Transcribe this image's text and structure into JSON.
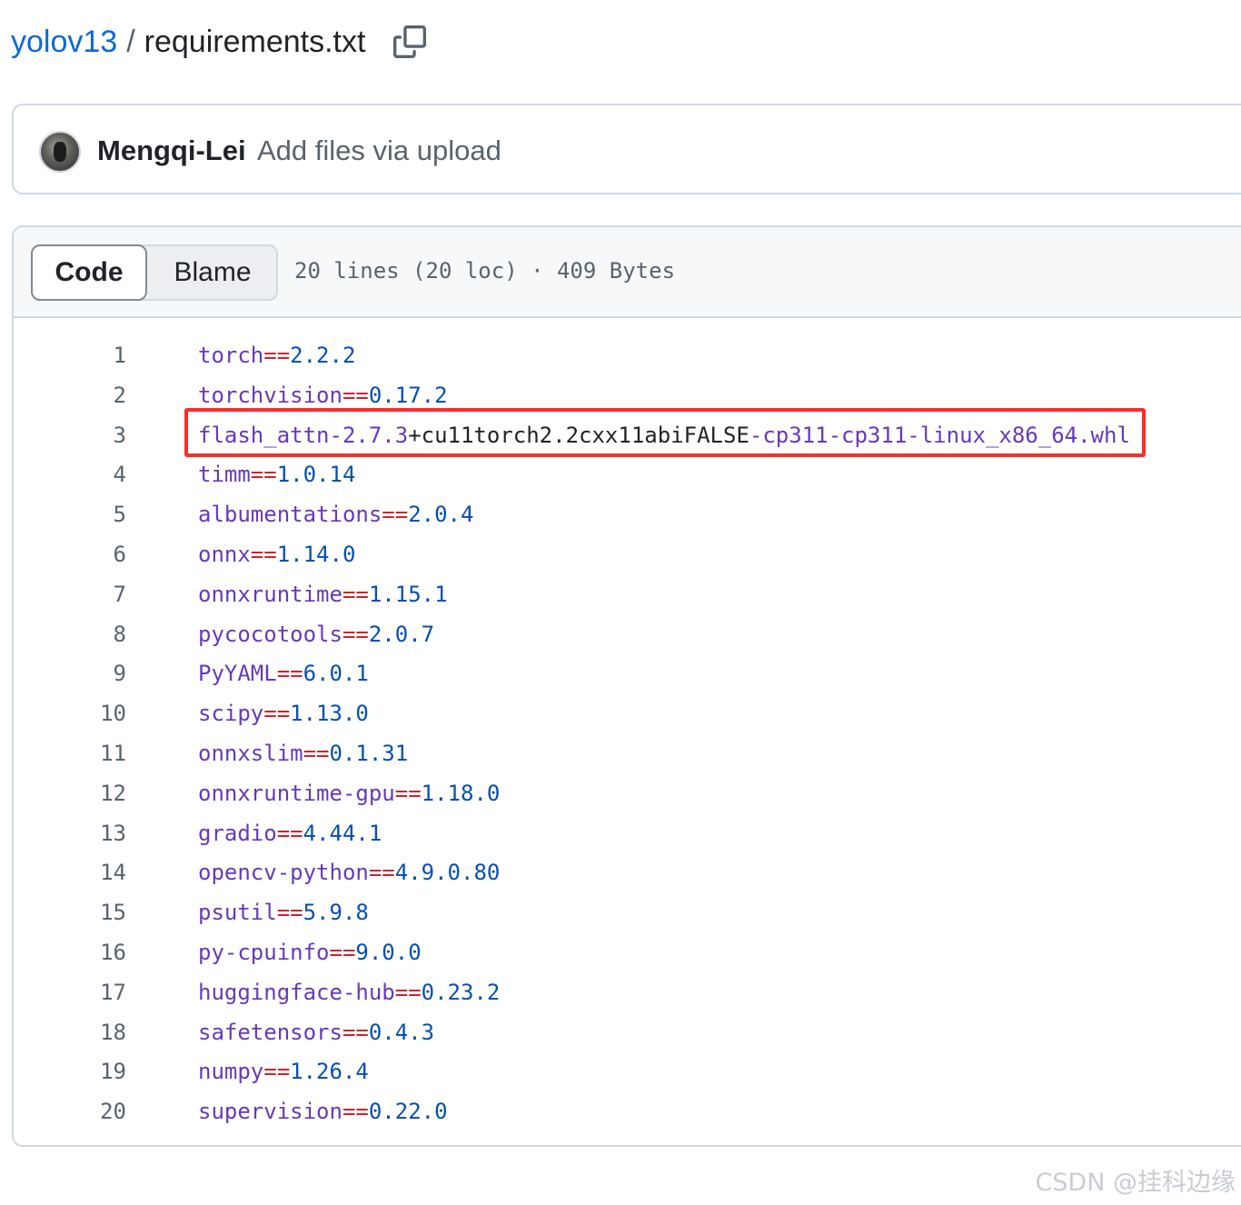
{
  "breadcrumb": {
    "repo": "yolov13",
    "separator": "/",
    "file": "requirements.txt"
  },
  "commit": {
    "author": "Mengqi-Lei",
    "message": "Add files via upload"
  },
  "file_header": {
    "tabs": [
      {
        "label": "Code",
        "active": true
      },
      {
        "label": "Blame",
        "active": false
      }
    ],
    "meta": "20 lines (20 loc) · 409 Bytes"
  },
  "code_lines": [
    {
      "num": "1",
      "tokens": [
        {
          "t": "name",
          "v": "torch"
        },
        {
          "t": "op",
          "v": "=="
        },
        {
          "t": "ver",
          "v": "2.2.2"
        }
      ]
    },
    {
      "num": "2",
      "tokens": [
        {
          "t": "name",
          "v": "torchvision"
        },
        {
          "t": "op",
          "v": "=="
        },
        {
          "t": "ver",
          "v": "0.17.2"
        }
      ]
    },
    {
      "num": "3",
      "tokens": [
        {
          "t": "name",
          "v": "flash_attn-2.7.3"
        },
        {
          "t": "plain",
          "v": "+cu11torch2.2cxx11abiFALSE"
        },
        {
          "t": "name",
          "v": "-cp311-cp311-linux_x86_64.whl"
        }
      ],
      "highlighted": true
    },
    {
      "num": "4",
      "tokens": [
        {
          "t": "name",
          "v": "timm"
        },
        {
          "t": "op",
          "v": "=="
        },
        {
          "t": "ver",
          "v": "1.0.14"
        }
      ]
    },
    {
      "num": "5",
      "tokens": [
        {
          "t": "name",
          "v": "albumentations"
        },
        {
          "t": "op",
          "v": "=="
        },
        {
          "t": "ver",
          "v": "2.0.4"
        }
      ]
    },
    {
      "num": "6",
      "tokens": [
        {
          "t": "name",
          "v": "onnx"
        },
        {
          "t": "op",
          "v": "=="
        },
        {
          "t": "ver",
          "v": "1.14.0"
        }
      ]
    },
    {
      "num": "7",
      "tokens": [
        {
          "t": "name",
          "v": "onnxruntime"
        },
        {
          "t": "op",
          "v": "=="
        },
        {
          "t": "ver",
          "v": "1.15.1"
        }
      ]
    },
    {
      "num": "8",
      "tokens": [
        {
          "t": "name",
          "v": "pycocotools"
        },
        {
          "t": "op",
          "v": "=="
        },
        {
          "t": "ver",
          "v": "2.0.7"
        }
      ]
    },
    {
      "num": "9",
      "tokens": [
        {
          "t": "name",
          "v": "PyYAML"
        },
        {
          "t": "op",
          "v": "=="
        },
        {
          "t": "ver",
          "v": "6.0.1"
        }
      ]
    },
    {
      "num": "10",
      "tokens": [
        {
          "t": "name",
          "v": "scipy"
        },
        {
          "t": "op",
          "v": "=="
        },
        {
          "t": "ver",
          "v": "1.13.0"
        }
      ]
    },
    {
      "num": "11",
      "tokens": [
        {
          "t": "name",
          "v": "onnxslim"
        },
        {
          "t": "op",
          "v": "=="
        },
        {
          "t": "ver",
          "v": "0.1.31"
        }
      ]
    },
    {
      "num": "12",
      "tokens": [
        {
          "t": "name",
          "v": "onnxruntime-gpu"
        },
        {
          "t": "op",
          "v": "=="
        },
        {
          "t": "ver",
          "v": "1.18.0"
        }
      ]
    },
    {
      "num": "13",
      "tokens": [
        {
          "t": "name",
          "v": "gradio"
        },
        {
          "t": "op",
          "v": "=="
        },
        {
          "t": "ver",
          "v": "4.44.1"
        }
      ]
    },
    {
      "num": "14",
      "tokens": [
        {
          "t": "name",
          "v": "opencv-python"
        },
        {
          "t": "op",
          "v": "=="
        },
        {
          "t": "ver",
          "v": "4.9.0.80"
        }
      ]
    },
    {
      "num": "15",
      "tokens": [
        {
          "t": "name",
          "v": "psutil"
        },
        {
          "t": "op",
          "v": "=="
        },
        {
          "t": "ver",
          "v": "5.9.8"
        }
      ]
    },
    {
      "num": "16",
      "tokens": [
        {
          "t": "name",
          "v": "py-cpuinfo"
        },
        {
          "t": "op",
          "v": "=="
        },
        {
          "t": "ver",
          "v": "9.0.0"
        }
      ]
    },
    {
      "num": "17",
      "tokens": [
        {
          "t": "name",
          "v": "huggingface-hub"
        },
        {
          "t": "op",
          "v": "=="
        },
        {
          "t": "ver",
          "v": "0.23.2"
        }
      ]
    },
    {
      "num": "18",
      "tokens": [
        {
          "t": "name",
          "v": "safetensors"
        },
        {
          "t": "op",
          "v": "=="
        },
        {
          "t": "ver",
          "v": "0.4.3"
        }
      ]
    },
    {
      "num": "19",
      "tokens": [
        {
          "t": "name",
          "v": "numpy"
        },
        {
          "t": "op",
          "v": "=="
        },
        {
          "t": "ver",
          "v": "1.26.4"
        }
      ]
    },
    {
      "num": "20",
      "tokens": [
        {
          "t": "name",
          "v": "supervision"
        },
        {
          "t": "op",
          "v": "=="
        },
        {
          "t": "ver",
          "v": "0.22.0"
        }
      ]
    }
  ],
  "icons": {
    "copy": "copy-icon",
    "avatar": "avatar"
  },
  "colors": {
    "link": "#0969da",
    "token_name": "#6639ba",
    "token_operator": "#cf222e",
    "token_version": "#0550ae",
    "annotation_box": "#ff2a2a"
  },
  "watermark": "CSDN @挂科边缘"
}
